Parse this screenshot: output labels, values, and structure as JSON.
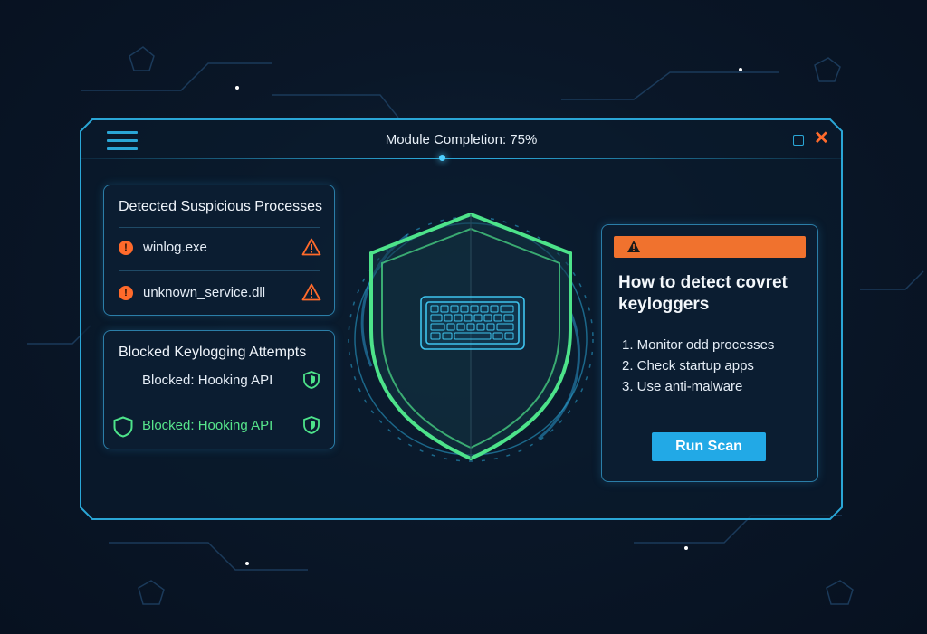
{
  "window": {
    "title": "Module Completion: 75%",
    "progress_percent": 75
  },
  "processes_panel": {
    "title": "Detected Suspicious Processes",
    "items": [
      {
        "name": "winlog.exe",
        "badge": "!"
      },
      {
        "name": "unknown_service.dll",
        "badge": "!"
      }
    ]
  },
  "blocked_panel": {
    "title": "Blocked Keylogging Attempts",
    "items": [
      {
        "label": "Blocked: Hooking API"
      },
      {
        "label": "Blocked: Hooking API"
      }
    ]
  },
  "guide_panel": {
    "title": "How to detect covret keyloggers",
    "steps": [
      "1. Monitor odd processes",
      "2. Check startup apps",
      "3. Use anti-malware"
    ],
    "button_label": "Run Scan"
  },
  "icons": {
    "menu": "hamburger-menu-icon",
    "maximize": "maximize-icon",
    "close": "close-icon",
    "warning": "warning-triangle-icon",
    "shield": "shield-icon",
    "keyboard": "keyboard-icon"
  },
  "colors": {
    "accent": "#2aa6d6",
    "warning": "#ff6a2b",
    "success": "#4de38a",
    "button": "#22a9e6",
    "alert_bar": "#f0722e"
  }
}
